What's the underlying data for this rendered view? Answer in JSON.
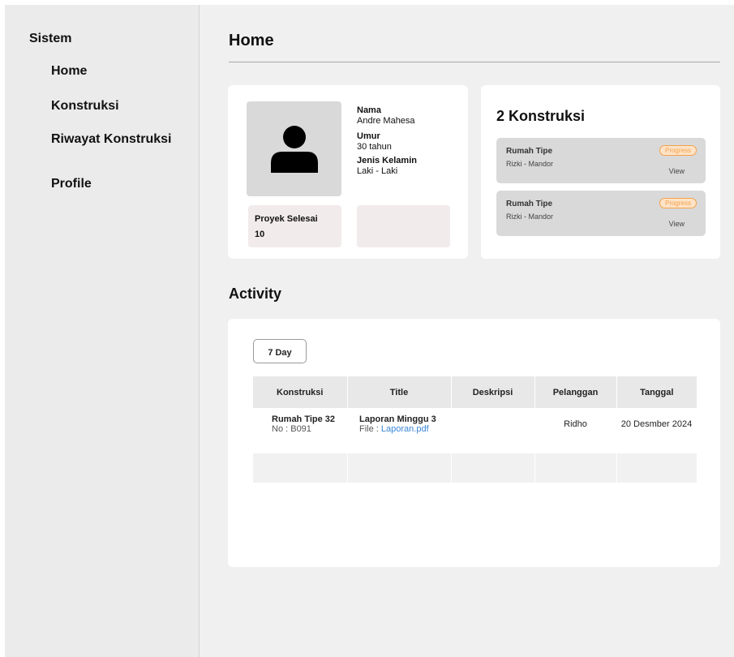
{
  "sidebar": {
    "brand": "Sistem",
    "items": [
      {
        "label": "Home"
      },
      {
        "label": "Konstruksi"
      },
      {
        "label": "Riwayat Konstruksi"
      },
      {
        "label": "Profile"
      }
    ]
  },
  "header": {
    "title": "Home"
  },
  "profile": {
    "nama_label": "Nama",
    "nama_value": "Andre Mahesa",
    "umur_label": "Umur",
    "umur_value": "30 tahun",
    "gender_label": "Jenis Kelamin",
    "gender_value": "Laki - Laki",
    "stat_label": "Proyek Selesai",
    "stat_value": "10",
    "avatar_icon": "user-icon"
  },
  "konstruksi": {
    "title": "2 Konstruksi",
    "items": [
      {
        "name": "Rumah Tipe",
        "sub": "Rizki - Mandor",
        "badge": "Progress",
        "view": "View"
      },
      {
        "name": "Rumah Tipe",
        "sub": "Rizki - Mandor",
        "badge": "Progress",
        "view": "View"
      }
    ]
  },
  "activity": {
    "title": "Activity",
    "filter_label": "7 Day",
    "columns": [
      "Konstruksi",
      "Title",
      "Deskripsi",
      "Pelanggan",
      "Tanggal"
    ],
    "rows": [
      {
        "konstruksi": "Rumah Tipe 32",
        "no": "No : B091",
        "title": "Laporan Minggu 3",
        "file_prefix": "File : ",
        "file_name": "Laporan.pdf",
        "deskripsi": "",
        "pelanggan": "Ridho",
        "tanggal": "20 Desmber 2024"
      }
    ]
  },
  "colors": {
    "background": "#f0f0f0",
    "sidebar": "#ebebeb",
    "card": "#ffffff",
    "badge": "#f6a14b",
    "link": "#3a86d6"
  }
}
